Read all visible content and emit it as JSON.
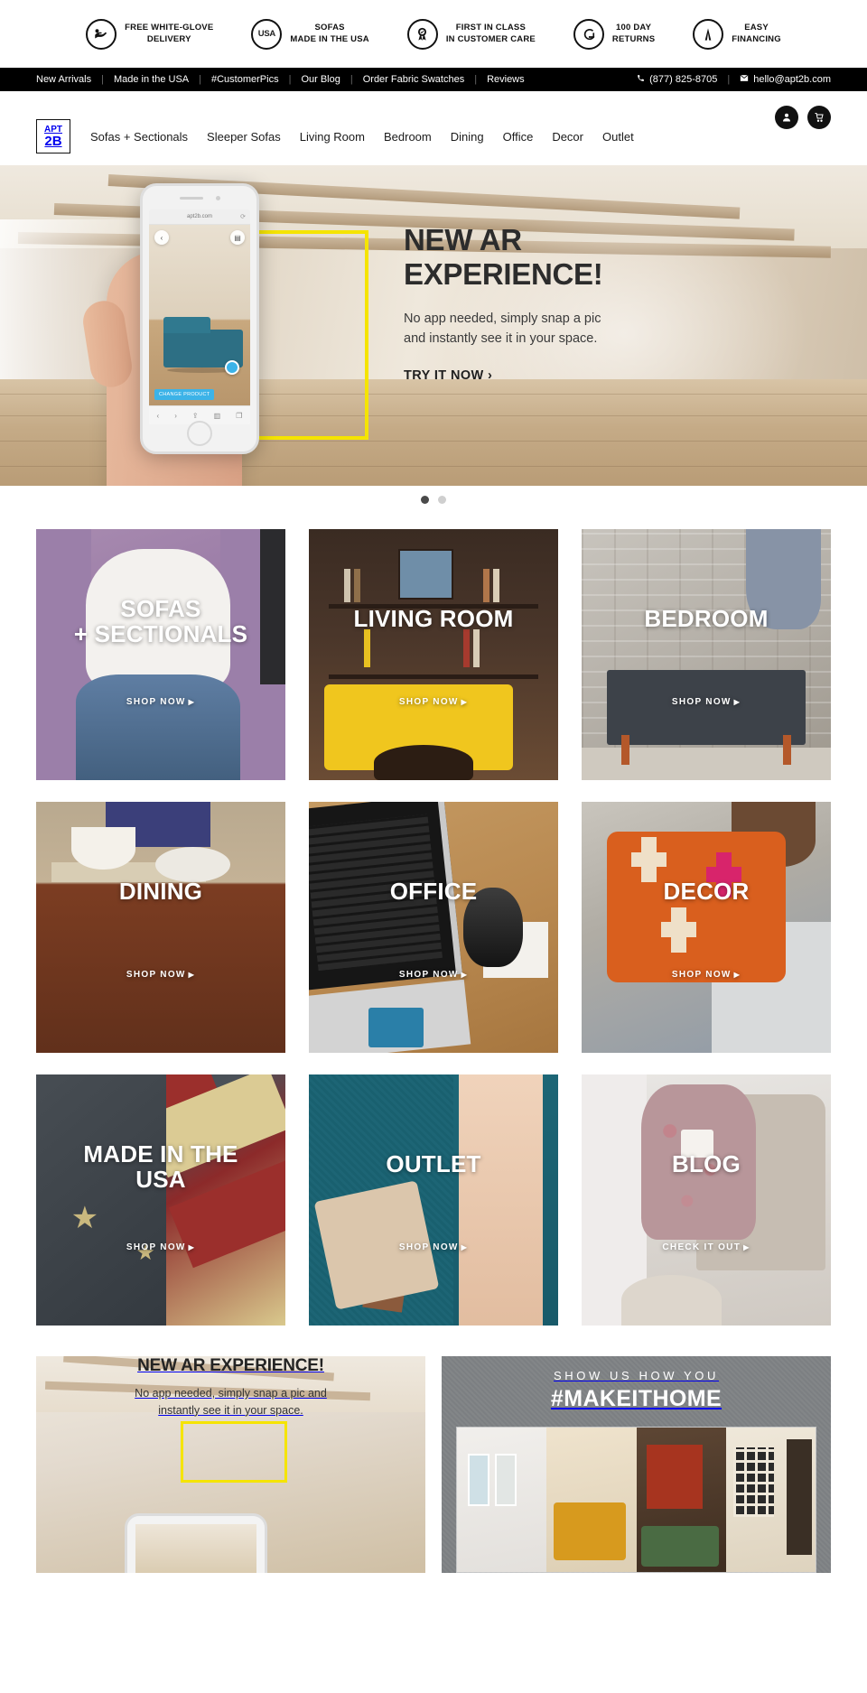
{
  "trust_bar": {
    "items": [
      {
        "icon": "white-glove-delivery-icon",
        "line1": "FREE WHITE-GLOVE",
        "line2": "DELIVERY"
      },
      {
        "icon": "usa-badge-icon",
        "line1": "SOFAS",
        "line2": "MADE IN THE USA"
      },
      {
        "icon": "award-ribbon-icon",
        "line1": "FIRST IN CLASS",
        "line2": "IN CUSTOMER CARE"
      },
      {
        "icon": "return-arrow-icon",
        "line1": "100 DAY",
        "line2": "RETURNS"
      },
      {
        "icon": "financing-icon",
        "line1": "EASY",
        "line2": "FINANCING"
      }
    ]
  },
  "util_bar": {
    "links": [
      {
        "label": "New Arrivals"
      },
      {
        "label": "Made in the USA"
      },
      {
        "label": "#CustomerPics"
      },
      {
        "label": "Our Blog"
      },
      {
        "label": "Order Fabric Swatches"
      },
      {
        "label": "Reviews"
      }
    ],
    "separator": "|",
    "phone": "(877) 825-8705",
    "email": "hello@apt2b.com"
  },
  "header": {
    "logo": {
      "top": "APT",
      "bottom": "2B"
    },
    "nav": [
      {
        "label": "Sofas + Sectionals"
      },
      {
        "label": "Sleeper Sofas"
      },
      {
        "label": "Living Room"
      },
      {
        "label": "Bedroom"
      },
      {
        "label": "Dining"
      },
      {
        "label": "Office"
      },
      {
        "label": "Decor"
      },
      {
        "label": "Outlet"
      }
    ],
    "account_icon": "user-account-icon",
    "cart_icon": "shopping-cart-icon"
  },
  "hero": {
    "title": "NEW AR\nEXPERIENCE!",
    "subtitle": "No app needed, simply snap a pic\nand instantly see it in your space.",
    "cta": "TRY IT NOW ›",
    "phone_url": "apt2b.com",
    "ar_chip": "CHANGE PRODUCT",
    "carousel": {
      "slide_count": 2,
      "active_index": 0
    }
  },
  "categories": [
    {
      "label": "SOFAS\n+ SECTIONALS",
      "cta": "SHOP NOW",
      "art": "t-sofas",
      "two_line": true
    },
    {
      "label": "LIVING ROOM",
      "cta": "SHOP NOW",
      "art": "t-living",
      "two_line": false
    },
    {
      "label": "BEDROOM",
      "cta": "SHOP NOW",
      "art": "t-bedroom",
      "two_line": false
    },
    {
      "label": "DINING",
      "cta": "SHOP NOW",
      "art": "t-dining",
      "two_line": false
    },
    {
      "label": "OFFICE",
      "cta": "SHOP NOW",
      "art": "t-office",
      "two_line": false
    },
    {
      "label": "DECOR",
      "cta": "SHOP NOW",
      "art": "t-decor",
      "two_line": false
    },
    {
      "label": "MADE IN THE\nUSA",
      "cta": "SHOP NOW",
      "art": "t-usa",
      "two_line": true
    },
    {
      "label": "OUTLET",
      "cta": "SHOP NOW",
      "art": "t-outlet",
      "two_line": false
    },
    {
      "label": "BLOG",
      "cta": "CHECK IT OUT",
      "art": "t-blog",
      "two_line": false
    }
  ],
  "bottom": {
    "ar_panel": {
      "title": "NEW AR EXPERIENCE!",
      "subtitle": "No app needed, simply snap a pic and\ninstantly see it in your space."
    },
    "hashtag_panel": {
      "supertitle": "SHOW US HOW YOU",
      "hashtag": "#MAKEITHOME"
    }
  },
  "colors": {
    "black": "#000000",
    "accent_yellow": "#f5e400",
    "text_dark": "#222222",
    "ar_blue": "#3cb3e8"
  }
}
